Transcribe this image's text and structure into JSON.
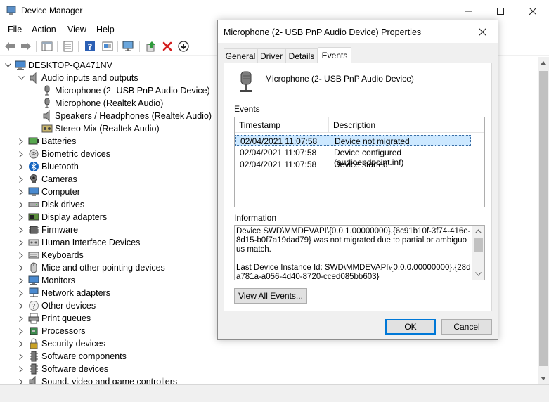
{
  "window": {
    "title": "Device Manager",
    "icon": "device-manager-icon"
  },
  "menu": [
    "File",
    "Action",
    "View",
    "Help"
  ],
  "toolbar": {
    "icons": [
      "back-icon",
      "forward-icon",
      "show-hide-icon",
      "properties-icon",
      "help-icon",
      "view-icon",
      "scan-hardware-icon",
      "update-driver-icon",
      "uninstall-icon",
      "disable-icon"
    ]
  },
  "tree": {
    "root": "DESKTOP-QA471NV",
    "audio": {
      "label": "Audio inputs and outputs",
      "children": [
        "Microphone (2- USB PnP Audio Device)",
        "Microphone (Realtek Audio)",
        "Speakers / Headphones (Realtek Audio)",
        "Stereo Mix (Realtek Audio)"
      ]
    },
    "categories": [
      "Batteries",
      "Biometric devices",
      "Bluetooth",
      "Cameras",
      "Computer",
      "Disk drives",
      "Display adapters",
      "Firmware",
      "Human Interface Devices",
      "Keyboards",
      "Mice and other pointing devices",
      "Monitors",
      "Network adapters",
      "Other devices",
      "Print queues",
      "Processors",
      "Security devices",
      "Software components",
      "Software devices",
      "Sound, video and game controllers"
    ]
  },
  "dialog": {
    "title": "Microphone (2- USB PnP Audio Device) Properties",
    "tabs": [
      "General",
      "Driver",
      "Details",
      "Events"
    ],
    "active_tab": "Events",
    "device_name": "Microphone (2- USB PnP Audio Device)",
    "events_label": "Events",
    "columns": [
      "Timestamp",
      "Description"
    ],
    "events": [
      {
        "timestamp": "02/04/2021 11:07:58",
        "description": "Device not migrated"
      },
      {
        "timestamp": "02/04/2021 11:07:58",
        "description": "Device configured (audioendpoint.inf)"
      },
      {
        "timestamp": "02/04/2021 11:07:58",
        "description": "Device started"
      }
    ],
    "information_label": "Information",
    "information_text": "Device SWD\\MMDEVAPI\\{0.0.1.00000000}.{6c91b10f-3f74-416e-8d15-b0f7a19dad79} was not migrated due to partial or ambiguous match.\n\nLast Device Instance Id: SWD\\MMDEVAPI\\{0.0.0.00000000}.{28da781a-a056-4d40-8720-cced085bb603}",
    "view_all_label": "View All Events...",
    "ok_label": "OK",
    "cancel_label": "Cancel"
  }
}
